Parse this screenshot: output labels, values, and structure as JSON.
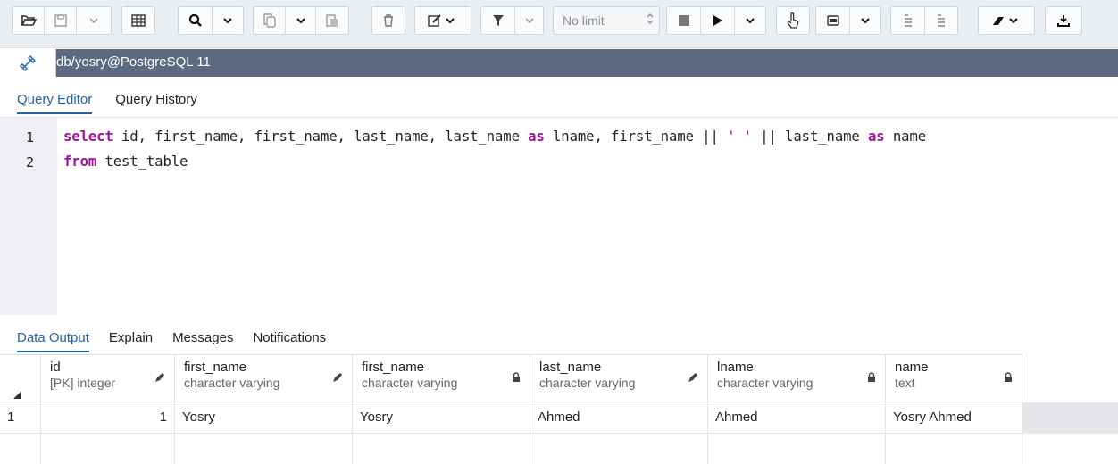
{
  "toolbar": {
    "icons": [
      "open-file-icon",
      "save-icon",
      "chevron-down-icon",
      "grid-icon",
      "search-icon",
      "chevron-down-icon",
      "copy-icon",
      "chevron-down-icon",
      "paste-icon",
      "delete-icon",
      "edit-icon",
      "chevron-down-icon",
      "filter-icon",
      "chevron-down-icon",
      "stop-icon",
      "play-icon",
      "chevron-down-icon",
      "hand-icon",
      "macro-icon",
      "chevron-down-icon",
      "commit-icon",
      "rollback-icon",
      "eraser-icon",
      "chevron-down-icon",
      "download-icon"
    ],
    "limit_label": "No limit"
  },
  "connection": {
    "label": "db/yosry@PostgreSQL 11"
  },
  "editor_tabs": [
    {
      "label": "Query Editor",
      "active": true
    },
    {
      "label": "Query History",
      "active": false
    }
  ],
  "editor": {
    "line_numbers": [
      "1",
      "2"
    ],
    "line1": {
      "kw_select": "select",
      "t1": " id, first_name, first_name, last_name, last_name ",
      "kw_as1": "as",
      "t2": " lname, first_name || ",
      "str": "' '",
      "t3": " || last_name ",
      "kw_as2": "as",
      "t4": " name"
    },
    "line2": {
      "kw_from": "from",
      "t1": " test_table"
    }
  },
  "output_tabs": [
    {
      "label": "Data Output",
      "active": true
    },
    {
      "label": "Explain",
      "active": false
    },
    {
      "label": "Messages",
      "active": false
    },
    {
      "label": "Notifications",
      "active": false
    }
  ],
  "grid": {
    "columns": [
      {
        "name": "id",
        "type": "[PK] integer",
        "icon": "pencil-icon"
      },
      {
        "name": "first_name",
        "type": "character varying",
        "icon": "pencil-icon"
      },
      {
        "name": "first_name",
        "type": "character varying",
        "icon": "lock-icon"
      },
      {
        "name": "last_name",
        "type": "character varying",
        "icon": "pencil-icon"
      },
      {
        "name": "lname",
        "type": "character varying",
        "icon": "lock-icon"
      },
      {
        "name": "name",
        "type": "text",
        "icon": "lock-icon"
      }
    ],
    "rows": [
      {
        "row_num": "1",
        "cells": [
          "1",
          "Yosry",
          "Yosry",
          "Ahmed",
          "Ahmed",
          "Yosry Ahmed"
        ]
      }
    ]
  },
  "colors": {
    "accent": "#2263a7",
    "connbar": "#5b6a80",
    "keyword": "#a1119c",
    "string": "#c8136f"
  }
}
